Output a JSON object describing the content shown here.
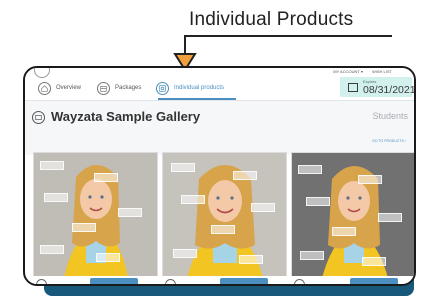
{
  "callout": {
    "title": "Individual Products"
  },
  "header": {
    "account_label": "MY ACCOUNT ▾",
    "wishlist_label": "WISH LIST",
    "nav": [
      {
        "label": "Overview",
        "icon": "home-icon"
      },
      {
        "label": "Packages",
        "icon": "package-icon"
      },
      {
        "label": "Individual products",
        "icon": "products-icon"
      }
    ],
    "expires_label": "Expires",
    "expires_date": "08/31/2021"
  },
  "gallery": {
    "title": "Wayzata Sample Gallery",
    "subtitle": "Students",
    "goto_link": "GO TO PRODUCTS ›"
  },
  "photos": [
    {
      "name": "photo-1",
      "bg": "#bfbdb6"
    },
    {
      "name": "photo-2",
      "bg": "#c6c2bc"
    },
    {
      "name": "photo-3",
      "bg": "#6a6a6a"
    }
  ],
  "colors": {
    "accent": "#4a8fc0",
    "shadow": "#18587a",
    "expires_bg": "#d2f1ee"
  }
}
